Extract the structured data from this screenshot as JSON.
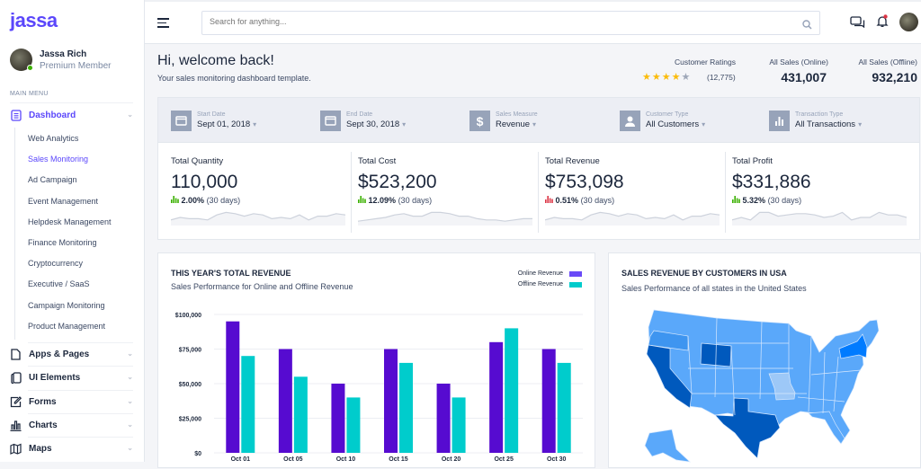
{
  "app": {
    "logo": "jassa"
  },
  "user": {
    "name": "Jassa Rich",
    "role": "Premium Member",
    "status_color": "#3bb001"
  },
  "sidebar": {
    "section_label": "MAIN MENU",
    "dashboard": {
      "label": "Dashboard",
      "icon": "document-icon",
      "subitems": [
        {
          "label": "Web Analytics"
        },
        {
          "label": "Sales Monitoring",
          "active": true
        },
        {
          "label": "Ad Campaign"
        },
        {
          "label": "Event Management"
        },
        {
          "label": "Helpdesk Management"
        },
        {
          "label": "Finance Monitoring"
        },
        {
          "label": "Cryptocurrency"
        },
        {
          "label": "Executive / SaaS"
        },
        {
          "label": "Campaign Monitoring"
        },
        {
          "label": "Product Management"
        }
      ]
    },
    "items": [
      {
        "label": "Apps & Pages",
        "icon": "page-icon"
      },
      {
        "label": "UI Elements",
        "icon": "layers-icon"
      },
      {
        "label": "Forms",
        "icon": "edit-icon"
      },
      {
        "label": "Charts",
        "icon": "bar-chart-icon"
      },
      {
        "label": "Maps",
        "icon": "map-icon"
      }
    ]
  },
  "topbar": {
    "search_placeholder": "Search for anything...",
    "notification_dot_color": "#dc3545"
  },
  "header": {
    "title": "Hi, welcome back!",
    "subtitle": "Your sales monitoring dashboard template.",
    "ratings": {
      "label": "Customer Ratings",
      "stars": 4,
      "max_stars": 5,
      "count": "(12,775)"
    },
    "online_sales": {
      "label": "All Sales (Online)",
      "value": "431,007"
    },
    "offline_sales": {
      "label": "All Sales (Offline)",
      "value": "932,210"
    }
  },
  "filters": [
    {
      "label": "Start Date",
      "value": "Sept 01, 2018",
      "icon": "calendar-icon"
    },
    {
      "label": "End Date",
      "value": "Sept 30, 2018",
      "icon": "calendar-icon"
    },
    {
      "label": "Sales Measure",
      "value": "Revenue",
      "icon": "dollar-icon"
    },
    {
      "label": "Customer Type",
      "value": "All Customers",
      "icon": "user-icon"
    },
    {
      "label": "Transaction Type",
      "value": "All Transactions",
      "icon": "bar-chart-icon"
    }
  ],
  "kpis": [
    {
      "title": "Total Quantity",
      "value": "110,000",
      "change": "2.00%",
      "period": "(30 days)",
      "trend": "up",
      "color": "#3bb001",
      "spark": [
        3,
        5,
        4,
        4,
        3,
        7,
        9,
        8,
        6,
        8,
        7,
        4,
        5,
        4,
        7,
        3,
        6,
        6,
        8,
        7
      ]
    },
    {
      "title": "Total Cost",
      "value": "$523,200",
      "change": "12.09%",
      "period": "(30 days)",
      "trend": "up",
      "color": "#3bb001",
      "spark": [
        2,
        3,
        4,
        5,
        7,
        8,
        6,
        6,
        9,
        9,
        8,
        6,
        6,
        4,
        3,
        3,
        2,
        3,
        4,
        4
      ]
    },
    {
      "title": "Total Revenue",
      "value": "$753,098",
      "change": "0.51%",
      "period": "(30 days)",
      "trend": "down",
      "color": "#dc3545",
      "spark": [
        3,
        5,
        4,
        4,
        3,
        7,
        9,
        8,
        6,
        8,
        7,
        4,
        5,
        4,
        7,
        3,
        6,
        6,
        8,
        7
      ]
    },
    {
      "title": "Total Profit",
      "value": "$331,886",
      "change": "5.32%",
      "period": "(30 days)",
      "trend": "up",
      "color": "#3bb001",
      "spark": [
        3,
        5,
        3,
        9,
        9,
        6,
        7,
        8,
        8,
        7,
        5,
        6,
        9,
        3,
        5,
        5,
        9,
        7,
        7,
        5
      ]
    }
  ],
  "revenue_card": {
    "title": "THIS YEAR'S TOTAL REVENUE",
    "subtitle": "Sales Performance for Online and Offline Revenue"
  },
  "map_card": {
    "title": "SALES REVENUE BY CUSTOMERS IN USA",
    "subtitle": "Sales Performance of all states in the United States",
    "highlighted_states": [
      {
        "state": "California",
        "level": "high",
        "color": "#0059bd"
      },
      {
        "state": "Texas",
        "level": "high",
        "color": "#0059bd"
      },
      {
        "state": "Wyoming",
        "level": "high",
        "color": "#0059bd"
      },
      {
        "state": "New York",
        "level": "medium-high",
        "color": "#007bff"
      },
      {
        "state": "Oregon",
        "level": "medium",
        "color": "#3e95f0"
      },
      {
        "state": "Missouri",
        "level": "low",
        "color": "#9dc8f7"
      }
    ],
    "default_color": "#5aa8fa"
  },
  "chart_data": {
    "type": "bar",
    "title": "THIS YEAR'S TOTAL REVENUE",
    "subtitle": "Sales Performance for Online and Offline Revenue",
    "categories": [
      "Oct 01",
      "Oct 05",
      "Oct 10",
      "Oct 15",
      "Oct 20",
      "Oct 25",
      "Oct 30"
    ],
    "series": [
      {
        "name": "Online Revenue",
        "color": "#560bd0",
        "legend_color": "#6a4af7",
        "values": [
          95000,
          75000,
          50000,
          75000,
          50000,
          80000,
          75000
        ]
      },
      {
        "name": "Offline Revenue",
        "color": "#00cccc",
        "legend_color": "#00cccc",
        "values": [
          70000,
          55000,
          40000,
          65000,
          40000,
          90000,
          65000
        ]
      }
    ],
    "yticks": [
      "$0",
      "$25,000",
      "$50,000",
      "$75,000",
      "$100,000"
    ],
    "ylim": [
      0,
      100000
    ],
    "grid": true,
    "legend": "top-right",
    "xlabel": "",
    "ylabel": ""
  }
}
